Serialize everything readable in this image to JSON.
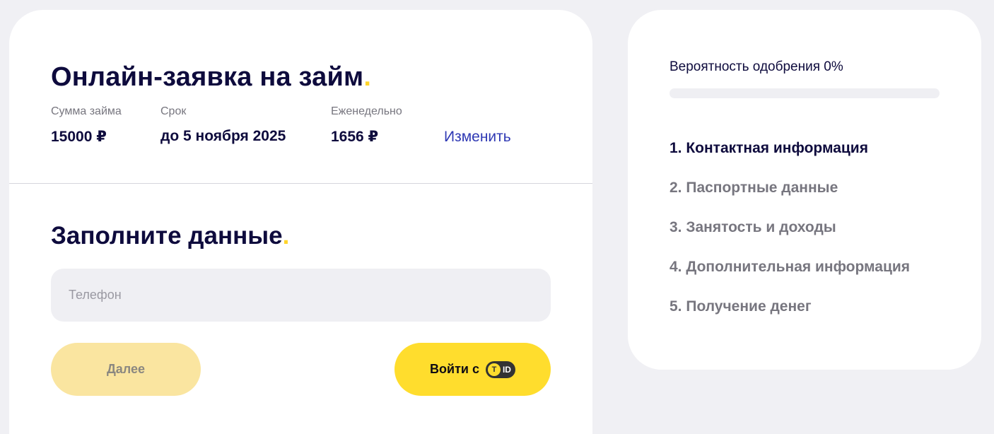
{
  "application": {
    "title": "Онлайн-заявка на займ",
    "title_dot": ".",
    "summary": [
      {
        "label": "Сумма займа",
        "value": "15000 ₽"
      },
      {
        "label": "Срок",
        "value": "до 5 ноября 2025"
      },
      {
        "label": "Еженедельно",
        "value": "1656 ₽"
      }
    ],
    "change_label": "Изменить"
  },
  "form": {
    "title": "Заполните данные",
    "title_dot": ".",
    "phone_placeholder": "Телефон",
    "phone_value": "",
    "next_label": "Далее",
    "tid_label": "Войти с",
    "tid_badge_letter": "T",
    "tid_badge_text": "ID"
  },
  "progress": {
    "label": "Вероятность одобрения 0%",
    "percent": 0,
    "steps": [
      {
        "label": "1. Контактная информация",
        "active": true
      },
      {
        "label": "2. Паспортные данные",
        "active": false
      },
      {
        "label": "3. Занятость и доходы",
        "active": false
      },
      {
        "label": "4. Дополнительная информация",
        "active": false
      },
      {
        "label": "5. Получение денег",
        "active": false
      }
    ]
  },
  "colors": {
    "accent": "#ffdd2d",
    "accent_disabled": "#fae5a0",
    "link": "#2f39b4",
    "text_dark": "#0e0b3d",
    "text_muted": "#77767f",
    "page_bg": "#f0f0f4"
  },
  "icons": {
    "tid_logo": "t-id-logo-icon"
  }
}
